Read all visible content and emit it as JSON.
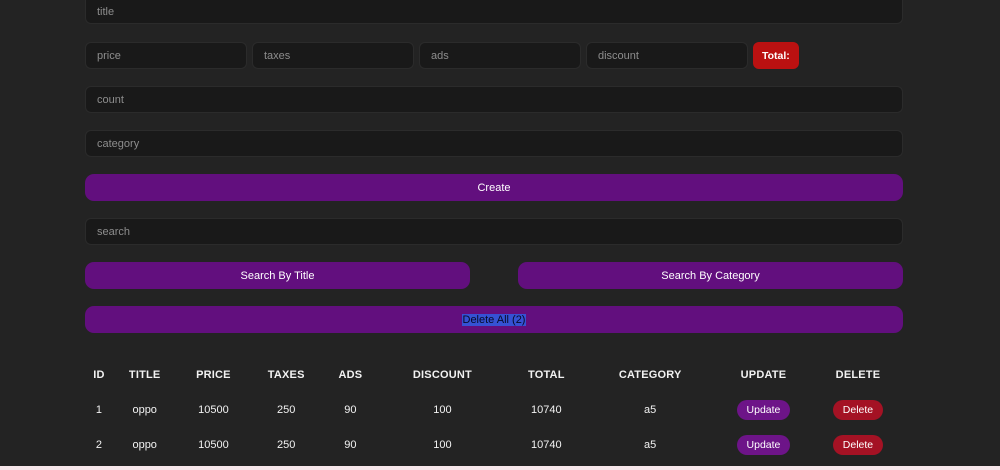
{
  "form": {
    "title_placeholder": "title",
    "price_placeholder": "price",
    "taxes_placeholder": "taxes",
    "ads_placeholder": "ads",
    "discount_placeholder": "discount",
    "total_label": "Total:",
    "count_placeholder": "count",
    "category_placeholder": "category",
    "create_label": "Create"
  },
  "search": {
    "placeholder": "search",
    "by_title_label": "Search By Title",
    "by_category_label": "Search By Category",
    "delete_all_label": "Delete All (2)",
    "delete_all_count": 2
  },
  "table": {
    "headers": [
      "ID",
      "TITLE",
      "PRICE",
      "TAXES",
      "ADS",
      "DISCOUNT",
      "TOTAL",
      "CATEGORY",
      "UPDATE",
      "DELETE"
    ],
    "rows": [
      {
        "id": "1",
        "title": "oppo",
        "price": "10500",
        "taxes": "250",
        "ads": "90",
        "discount": "100",
        "total": "10740",
        "category": "a5",
        "update_label": "Update",
        "delete_label": "Delete"
      },
      {
        "id": "2",
        "title": "oppo",
        "price": "10500",
        "taxes": "250",
        "ads": "90",
        "discount": "100",
        "total": "10740",
        "category": "a5",
        "update_label": "Update",
        "delete_label": "Delete"
      }
    ]
  },
  "colors": {
    "background_dark": "#232323",
    "input_background": "#191919",
    "accent_purple": "#620f7e",
    "total_badge_red": "#bb1111",
    "delete_pill_red": "#a41224",
    "update_pill_purple": "#6d1488",
    "selection_blue": "#3552d4",
    "page_bottom_pink": "#f7e6ea"
  }
}
